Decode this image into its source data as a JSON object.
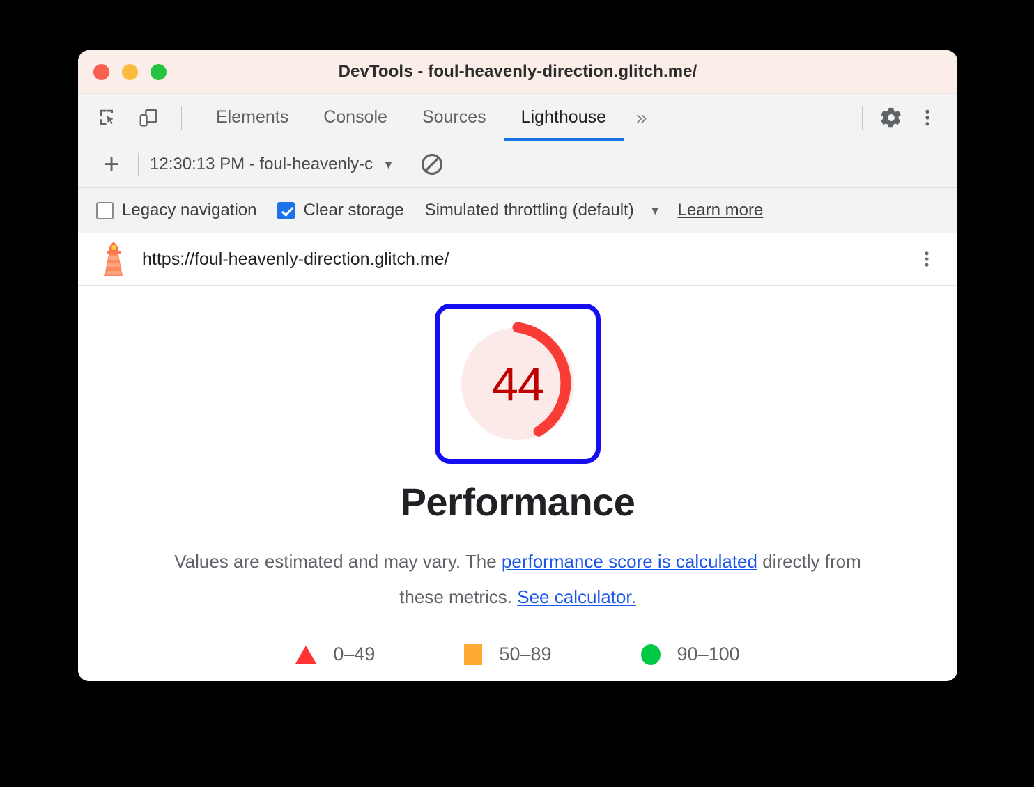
{
  "window": {
    "title": "DevTools - foul-heavenly-direction.glitch.me/",
    "traffic_lights": [
      "close",
      "minimize",
      "maximize"
    ]
  },
  "tabbar": {
    "inspect_icon": "inspect-element-icon",
    "device_icon": "device-toolbar-icon",
    "tabs": [
      {
        "label": "Elements",
        "active": false
      },
      {
        "label": "Console",
        "active": false
      },
      {
        "label": "Sources",
        "active": false
      },
      {
        "label": "Lighthouse",
        "active": true
      }
    ],
    "more_tabs_label": "»",
    "settings_icon": "gear-icon",
    "main_menu_icon": "three-dot-menu-icon"
  },
  "lighthouse_toolbar": {
    "new_run_label": "+",
    "run_selector_value": "12:30:13 PM - foul-heavenly-c",
    "run_selector_caret": "▼",
    "clear_icon": "clear-all-icon"
  },
  "options": {
    "legacy_navigation": {
      "label": "Legacy navigation",
      "checked": false
    },
    "clear_storage": {
      "label": "Clear storage",
      "checked": true
    },
    "throttling": {
      "value": "Simulated throttling (default)",
      "caret": "▼"
    },
    "learn_more": "Learn more"
  },
  "report": {
    "logo_icon": "lighthouse-icon",
    "url": "https://foul-heavenly-direction.glitch.me/",
    "menu_icon": "three-dot-menu-icon"
  },
  "score": {
    "value": "44",
    "category": "Performance",
    "disclaimer_part1": "Values are estimated and may vary. The ",
    "disclaimer_link1": "performance score is calculated",
    "disclaimer_part2": " directly from these metrics. ",
    "disclaimer_link2": "See calculator."
  },
  "legend": [
    {
      "marker": "triangle",
      "range": "0–49",
      "color": "#ff3333"
    },
    {
      "marker": "square",
      "range": "50–89",
      "color": "#ffaa33"
    },
    {
      "marker": "circle",
      "range": "90–100",
      "color": "#00c844"
    }
  ],
  "chart_data": {
    "type": "gauge",
    "title": "Performance",
    "value": 44,
    "min": 0,
    "max": 100,
    "arc_fraction": 0.44,
    "arc_color": "#ff3333",
    "track_color": "#fbeae8",
    "bands": [
      {
        "label": "0–49",
        "from": 0,
        "to": 49,
        "color": "#ff3333"
      },
      {
        "label": "50–89",
        "from": 50,
        "to": 89,
        "color": "#ffaa33"
      },
      {
        "label": "90–100",
        "from": 90,
        "to": 100,
        "color": "#00c844"
      }
    ]
  }
}
